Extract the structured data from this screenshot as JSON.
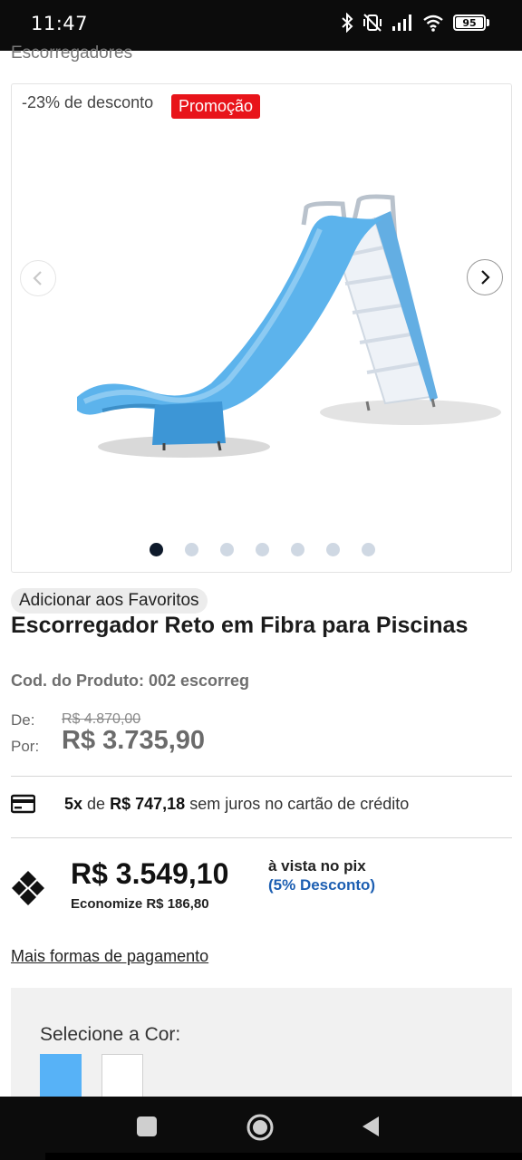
{
  "statusbar": {
    "time": "11:47",
    "battery": "95",
    "icons": [
      "bluetooth-icon",
      "vibrate-off-icon",
      "signal-icon",
      "wifi-icon",
      "battery-icon"
    ]
  },
  "breadcrumb": "Escorregadores",
  "gallery": {
    "discount_text": "-23% de desconto",
    "promo_badge": "Promoção",
    "dots_total": 7,
    "active_dot": 1
  },
  "product": {
    "favorite_label": "Adicionar aos Favoritos",
    "title": "Escorregador Reto em Fibra para Piscinas",
    "code": "Cod. do Produto: 002 escorreg",
    "de_label": "De:",
    "por_label": "Por:",
    "old_price": "R$ 4.870,00",
    "price": "R$ 3.735,90"
  },
  "installment": {
    "count": "5x",
    "de": "de",
    "value": "R$ 747,18",
    "rest": "sem juros no cartão de crédito"
  },
  "pix": {
    "price": "R$ 3.549,10",
    "savings": "Economize R$ 186,80",
    "label": "à vista no pix",
    "discount": "(5% Desconto)"
  },
  "more_payments": "Mais formas de pagamento",
  "color_selector": {
    "label": "Selecione a Cor:",
    "options": [
      {
        "name": "azul",
        "color": "#57b2f7"
      },
      {
        "name": "branco",
        "color": "#ffffff"
      }
    ]
  },
  "colors": {
    "promo": "#e8141a",
    "pix_discount": "#1d5fb2",
    "active_dot": "#0e1a2b",
    "inactive_dot": "#cfd8e3"
  }
}
